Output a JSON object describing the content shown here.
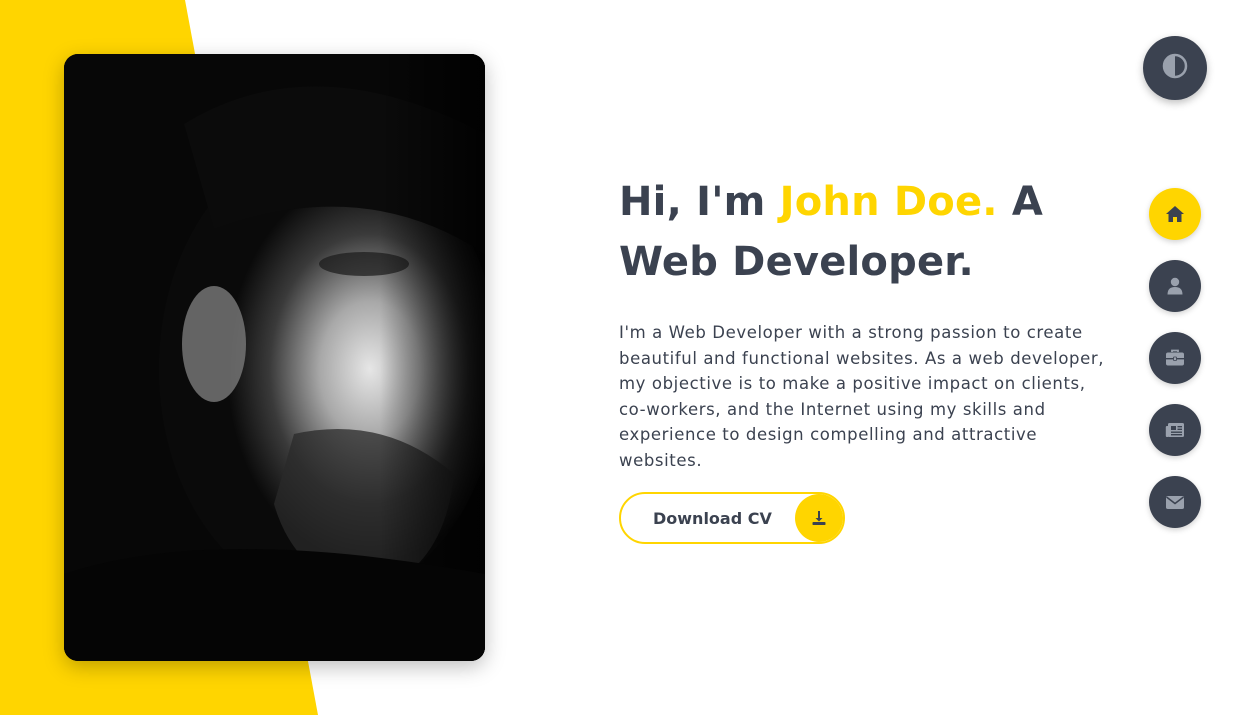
{
  "colors": {
    "accent": "#ffd500",
    "dark": "#3b4250",
    "icon_muted": "#9aa1ad",
    "background": "#ffffff"
  },
  "hero": {
    "title_prefix": "Hi, I'm ",
    "title_name": "John Doe.",
    "title_suffix": " A Web Developer.",
    "description": "I'm a Web Developer with a strong passion to create beautiful and functional websites. As a web developer, my objective is to make a positive impact on clients, co-workers, and the Internet using my skills and experience to design compelling and attractive websites."
  },
  "cv_button": {
    "label": "Download CV",
    "icon": "download-icon"
  },
  "theme_toggle": {
    "icon": "contrast-icon"
  },
  "nav": {
    "items": [
      {
        "id": "home",
        "icon": "home-icon",
        "active": true
      },
      {
        "id": "about",
        "icon": "user-icon",
        "active": false
      },
      {
        "id": "portfolio",
        "icon": "briefcase-icon",
        "active": false
      },
      {
        "id": "blog",
        "icon": "newspaper-icon",
        "active": false
      },
      {
        "id": "contact",
        "icon": "envelope-icon",
        "active": false
      }
    ]
  },
  "portrait": {
    "icon": "profile-photo"
  }
}
